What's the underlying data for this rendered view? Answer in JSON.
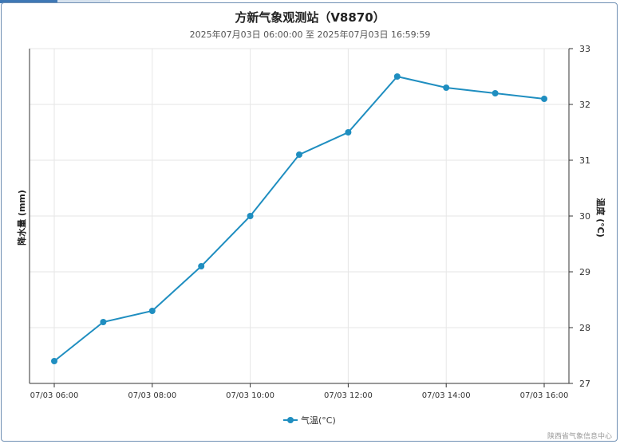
{
  "title": "方新气象观测站（V8870）",
  "subtitle": "2025年07月03日 06:00:00 至 2025年07月03日 16:59:59",
  "credit": "陕西省气象信息中心",
  "chart_data": {
    "type": "line",
    "x_tick_labels": [
      "07/03 06:00",
      "07/03 08:00",
      "07/03 10:00",
      "07/03 12:00",
      "07/03 14:00",
      "07/03 16:00"
    ],
    "x": [
      "07/03 06:00",
      "07/03 07:00",
      "07/03 08:00",
      "07/03 09:00",
      "07/03 10:00",
      "07/03 11:00",
      "07/03 12:00",
      "07/03 13:00",
      "07/03 14:00",
      "07/03 15:00",
      "07/03 16:00"
    ],
    "series": [
      {
        "name": "气温(°C)",
        "values": [
          27.4,
          28.1,
          28.3,
          29.1,
          30.0,
          31.1,
          31.5,
          32.5,
          32.3,
          32.2,
          32.1
        ],
        "color": "#1f8ec0",
        "axis": "right"
      }
    ],
    "y_left_label": "降水量 (mm)",
    "y_right_label": "温度 (°C)",
    "y_right_ticks": [
      "27",
      "28",
      "29",
      "30",
      "31",
      "32",
      "33"
    ],
    "y_right_range": [
      27,
      33
    ],
    "grid": true,
    "legend_position": "bottom"
  }
}
